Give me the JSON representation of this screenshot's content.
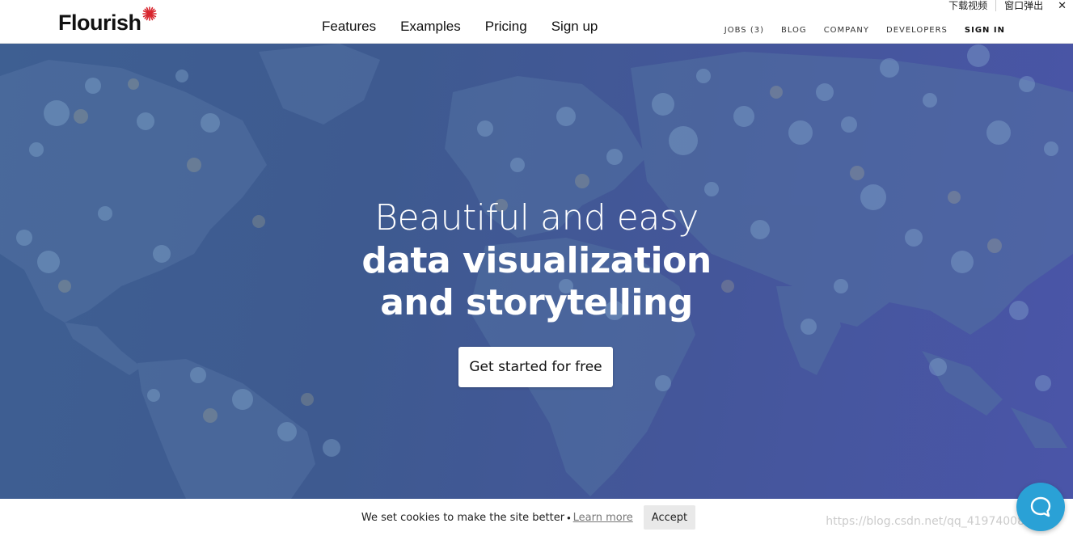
{
  "brand": {
    "name": "Flourish",
    "accent_color": "#d8262e"
  },
  "nav": {
    "main": [
      "Features",
      "Examples",
      "Pricing",
      "Sign up"
    ],
    "utility": [
      "JOBS (3)",
      "BLOG",
      "COMPANY",
      "DEVELOPERS"
    ],
    "signin": "SIGN IN"
  },
  "overlay": {
    "download_video": "下载视频",
    "window_popup": "窗口弹出",
    "close_glyph": "✕"
  },
  "hero": {
    "line1": "Beautiful and easy",
    "line2": "data visualization",
    "line3": "and storytelling",
    "cta": "Get started for free",
    "background_color": "#425a96"
  },
  "cookie": {
    "message": "We set cookies to make the site better",
    "separator": "•",
    "learn_more": "Learn more",
    "accept": "Accept"
  },
  "watermark": "https://blog.csdn.net/qq_41974008",
  "help_button": {
    "icon": "chat-bubble-icon",
    "color": "#2aa1d6"
  }
}
